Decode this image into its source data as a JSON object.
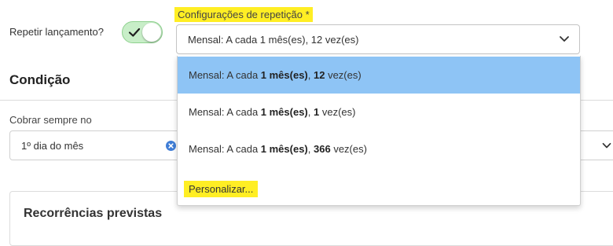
{
  "repeat": {
    "label": "Repetir lançamento?",
    "enabled": true
  },
  "config": {
    "label": "Configurações de repetição *",
    "selected_value": "Mensal: A cada 1 mês(es), 12 vez(es)",
    "options": [
      {
        "prefix": "Mensal: A cada ",
        "period": "1 mês(es)",
        "sep": ", ",
        "count": "12",
        "suffix": " vez(es)",
        "selected": true
      },
      {
        "prefix": "Mensal: A cada ",
        "period": "1 mês(es)",
        "sep": ", ",
        "count": "1",
        "suffix": " vez(es)",
        "selected": false
      },
      {
        "prefix": "Mensal: A cada ",
        "period": "1 mês(es)",
        "sep": ", ",
        "count": "366",
        "suffix": " vez(es)",
        "selected": false
      }
    ],
    "custom_label": "Personalizar..."
  },
  "condition": {
    "title": "Condição",
    "charge_label": "Cobrar sempre no",
    "charge_value": "1º dia do mês"
  },
  "recurrences": {
    "title": "Recorrências previstas"
  },
  "colors": {
    "highlight": "#ffee24",
    "selected_option": "#8ec4f5",
    "toggle_on": "#c8eec8",
    "clear_icon": "#3f7dd6"
  }
}
